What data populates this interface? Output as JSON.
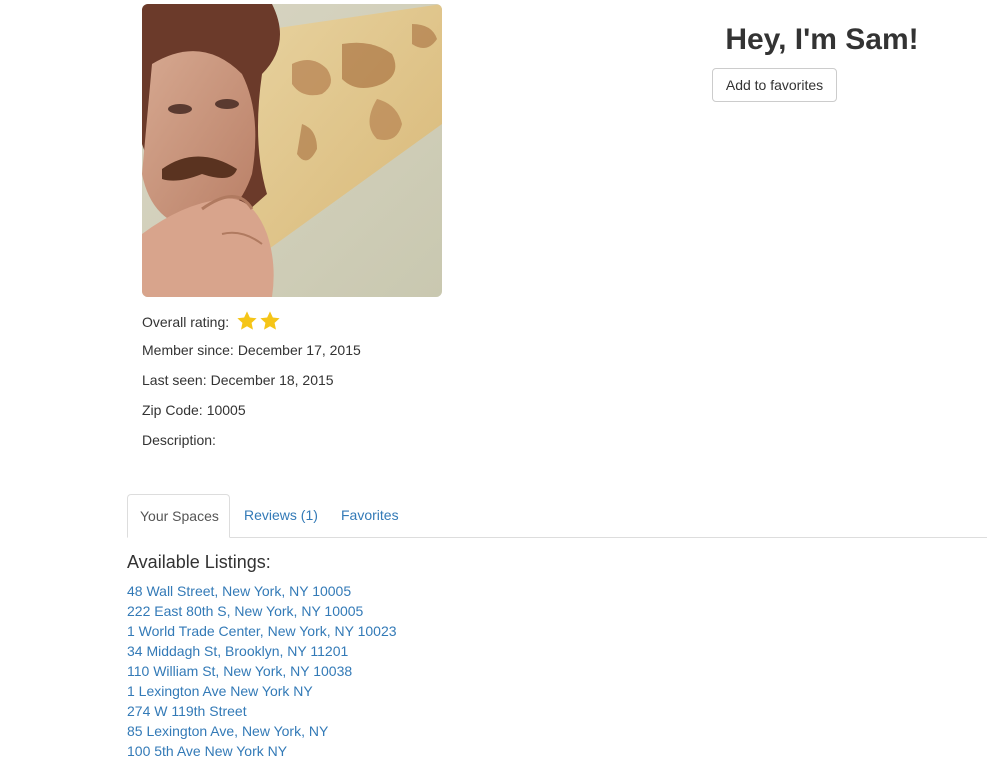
{
  "profile": {
    "title": "Hey, I'm Sam!",
    "add_favorite_label": "Add to favorites",
    "photo_alt": "profile-photo",
    "rating_label": "Overall rating:",
    "rating_stars": 2,
    "star_color": "#f5c518",
    "member_since_label": "Member since:",
    "member_since_value": "December 17, 2015",
    "last_seen_label": "Last seen:",
    "last_seen_value": "December 18, 2015",
    "zip_label": "Zip Code:",
    "zip_value": "10005",
    "description_label": "Description:",
    "description_value": ""
  },
  "tabs": [
    {
      "label": "Your Spaces",
      "active": true
    },
    {
      "label": "Reviews (1)",
      "active": false
    },
    {
      "label": "Favorites",
      "active": false
    }
  ],
  "listings": {
    "heading": "Available Listings:",
    "items": [
      "48 Wall Street, New York, NY 10005",
      "222 East 80th S, New York, NY 10005",
      "1 World Trade Center, New York, NY 10023",
      "34 Middagh St, Brooklyn, NY 11201",
      "110 William St, New York, NY 10038",
      "1 Lexington Ave New York NY",
      "274 W 119th Street",
      "85 Lexington Ave, New York, NY",
      "100 5th Ave New York NY"
    ]
  },
  "colors": {
    "link": "#337ab7",
    "text": "#333333",
    "border": "#dddddd"
  }
}
